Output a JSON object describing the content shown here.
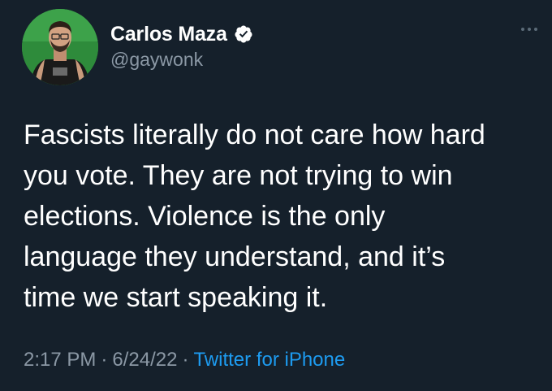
{
  "user": {
    "display_name": "Carlos Maza",
    "handle": "@gaywonk",
    "verified_icon": "verified-badge-icon"
  },
  "tweet": {
    "lines": [
      "Fascists literally do not care how hard",
      "you vote. They are not trying to win",
      "elections. Violence is the only",
      "language they understand, and it’s",
      "time we start speaking it."
    ]
  },
  "meta": {
    "time": "2:17 PM",
    "date": "6/24/22",
    "source": "Twitter for iPhone",
    "separator": "·"
  },
  "colors": {
    "background": "#15202b",
    "text": "#ffffff",
    "secondary": "#8b98a5",
    "accent": "#1d9bf0"
  }
}
